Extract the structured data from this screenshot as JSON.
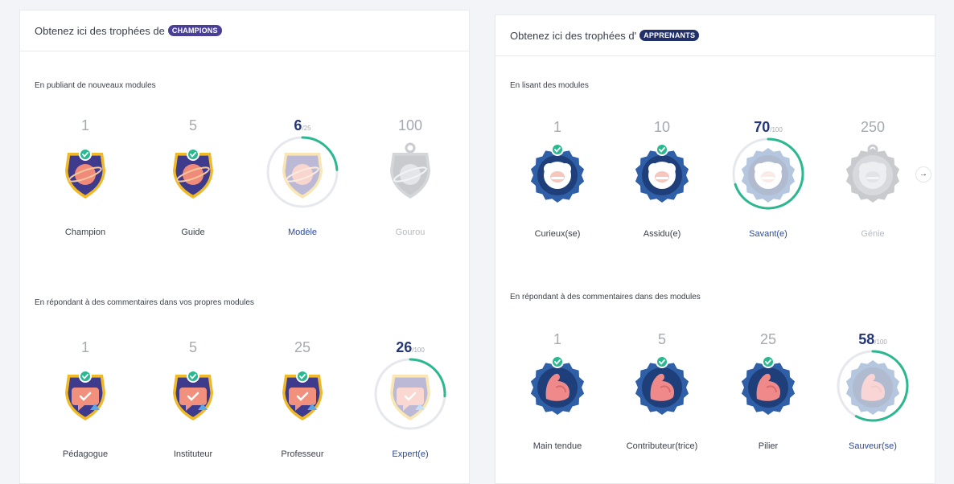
{
  "colors": {
    "accent_green": "#2bb78f",
    "champion_pill": "#4a3f96",
    "learner_pill": "#22306a",
    "active_text": "#2e4a96"
  },
  "left": {
    "header_text": "Obtenez ici des trophées de",
    "pill": "CHAMPIONS",
    "sections": [
      {
        "label": "En publiant de nouveaux modules",
        "trophies": [
          {
            "count": "1",
            "max": "",
            "name": "Champion",
            "state": "earned",
            "icon": "planet-shield-icon"
          },
          {
            "count": "5",
            "max": "",
            "name": "Guide",
            "state": "earned",
            "icon": "planet-shield-icon"
          },
          {
            "count": "6",
            "max": "/25",
            "name": "Modèle",
            "state": "progress",
            "progress": 0.24,
            "icon": "planet-shield-icon"
          },
          {
            "count": "100",
            "max": "",
            "name": "Gourou",
            "state": "locked",
            "icon": "planet-medal-icon"
          }
        ]
      },
      {
        "label": "En répondant à des commentaires dans vos propres modules",
        "trophies": [
          {
            "count": "1",
            "max": "",
            "name": "Pédagogue",
            "state": "earned",
            "icon": "chat-shield-icon"
          },
          {
            "count": "5",
            "max": "",
            "name": "Instituteur",
            "state": "earned",
            "icon": "chat-shield-icon"
          },
          {
            "count": "25",
            "max": "",
            "name": "Professeur",
            "state": "earned",
            "icon": "chat-shield-icon"
          },
          {
            "count": "26",
            "max": "/100",
            "name": "Expert(e)",
            "state": "progress",
            "progress": 0.26,
            "icon": "chat-shield-icon"
          }
        ]
      }
    ]
  },
  "right": {
    "header_text": "Obtenez ici des trophées d'",
    "pill": "APPRENANTS",
    "sections": [
      {
        "label": "En lisant des modules",
        "trophies": [
          {
            "count": "1",
            "max": "",
            "name": "Curieux(se)",
            "state": "earned",
            "icon": "einstein-badge-icon"
          },
          {
            "count": "10",
            "max": "",
            "name": "Assidu(e)",
            "state": "earned",
            "icon": "einstein-badge-icon"
          },
          {
            "count": "70",
            "max": "/100",
            "name": "Savant(e)",
            "state": "progress",
            "progress": 0.7,
            "icon": "einstein-badge-icon"
          },
          {
            "count": "250",
            "max": "",
            "name": "Génie",
            "state": "locked",
            "icon": "einstein-medal-icon"
          }
        ]
      },
      {
        "label": "En répondant à des commentaires dans des modules",
        "trophies": [
          {
            "count": "1",
            "max": "",
            "name": "Main tendue",
            "state": "earned",
            "icon": "muscle-badge-icon"
          },
          {
            "count": "5",
            "max": "",
            "name": "Contributeur(trice)",
            "state": "earned",
            "icon": "muscle-badge-icon"
          },
          {
            "count": "25",
            "max": "",
            "name": "Pilier",
            "state": "earned",
            "icon": "muscle-badge-icon"
          },
          {
            "count": "58",
            "max": "/100",
            "name": "Sauveur(se)",
            "state": "progress",
            "progress": 0.58,
            "icon": "muscle-badge-icon"
          }
        ]
      }
    ],
    "next_arrow": "→"
  }
}
